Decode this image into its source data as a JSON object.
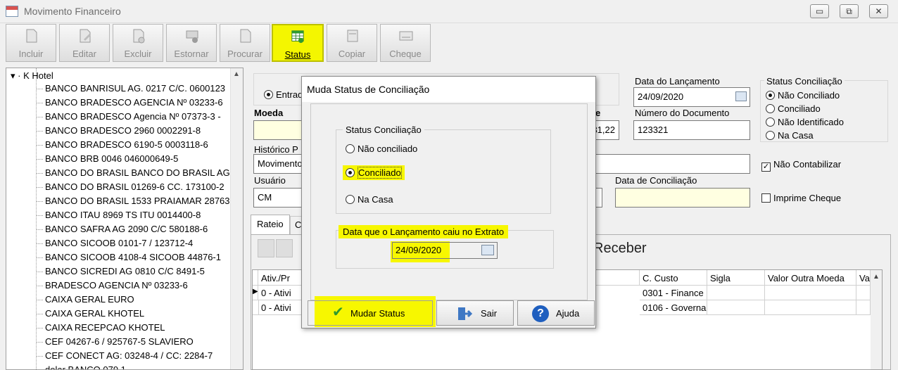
{
  "window": {
    "title": "Movimento Financeiro",
    "controls": [
      "▭",
      "⧉",
      "✕"
    ]
  },
  "toolbar": {
    "buttons": [
      {
        "label": "Incluir",
        "icon": "new-document-icon",
        "enabled": false
      },
      {
        "label": "Editar",
        "icon": "edit-document-icon",
        "enabled": false
      },
      {
        "label": "Excluir",
        "icon": "delete-document-icon",
        "enabled": false
      },
      {
        "label": "Estornar",
        "icon": "reverse-icon",
        "enabled": false
      },
      {
        "label": "Procurar",
        "icon": "search-document-icon",
        "enabled": false
      },
      {
        "label": "Status",
        "icon": "status-grid-icon",
        "enabled": true,
        "highlighted": true
      },
      {
        "label": "Copiar",
        "icon": "copy-icon",
        "enabled": false
      },
      {
        "label": "Cheque",
        "icon": "cheque-icon",
        "enabled": false
      }
    ]
  },
  "tree": {
    "root": "K Hotel",
    "items": [
      "BANCO BANRISUL AG. 0217 C/C. 0600123",
      "BANCO BRADESCO AGENCIA Nº 03233-6",
      "BANCO BRADESCO Agencia Nº 07373-3 -",
      "BANCO BRADESCO 2960 0002291-8",
      "BANCO BRADESCO 6190-5 0003118-6",
      "BANCO BRB 0046 046000649-5",
      "BANCO DO BRASIL BANCO DO BRASIL AG",
      "BANCO DO BRASIL 01269-6 CC. 173100-2",
      "BANCO DO BRASIL 1533 PRAIAMAR 28763",
      "BANCO ITAU 8969 TS ITU 0014400-8",
      "BANCO SAFRA AG 2090 C/C 580188-6",
      "BANCO SICOOB 0101-7 / 123712-4",
      "BANCO SICOOB 4108-4 SICOOB 44876-1",
      "BANCO SICREDI AG 0810 C/C 8491-5",
      "BRADESCO AGENCIA Nº 03233-6",
      "CAIXA GERAL EURO",
      "CAIXA GERAL KHOTEL",
      "CAIXA RECEPCAO KHOTEL",
      "CEF  04267-6 / 925767-5 SLAVIERO",
      "CEF CONECT AG: 03248-4 / CC: 2284-7",
      "dolar BANCO 079 1"
    ]
  },
  "form": {
    "entrada_label": "Entrad",
    "moeda_label": "Moeda",
    "valor_partial": "31,22",
    "valor_label_partial": "e",
    "historico_label": "Histórico P",
    "historico_value": "Movimento",
    "usuario_label": "Usuário",
    "usuario_value": "CM",
    "data_lancamento_label": "Data do Lançamento",
    "data_lancamento_value": "24/09/2020",
    "numero_documento_label": "Número do Documento",
    "numero_documento_value": "123321",
    "data_conciliacao_label": "Data de Conciliação",
    "data_conciliacao_value": "",
    "status_group_title": "Status Conciliação",
    "status_options": [
      "Não Conciliado",
      "Conciliado",
      "Não Identificado",
      "Na Casa"
    ],
    "status_selected": "Não Conciliado",
    "nao_contabilizar_label": "Não Contabilizar",
    "nao_contabilizar_checked": true,
    "imprime_cheque_label": "Imprime Cheque",
    "imprime_cheque_checked": false
  },
  "tabs": [
    "Rateio",
    "C"
  ],
  "receber_label": "Receber",
  "grid": {
    "columns": [
      "Ativ./Pr",
      "C. Custo",
      "Sigla",
      "Valor Outra Moeda",
      "Va"
    ],
    "rows": [
      {
        "ativ": "0 - Ativi",
        "custo": "0301 - Finance",
        "selected": true
      },
      {
        "ativ": "0 - Ativi",
        "custo": "0106 - Governa",
        "selected": false
      }
    ]
  },
  "dialog": {
    "title": "Muda Status de Conciliação",
    "group_title": "Status Conciliação",
    "options": [
      "Não conciliado",
      "Conciliado",
      "Na Casa"
    ],
    "selected": "Conciliado",
    "date_group_title": "Data que o Lançamento caiu no Extrato",
    "date_value": "24/09/2020",
    "buttons": {
      "mudar": "Mudar Status",
      "sair": "Sair",
      "ajuda": "Ajuda"
    }
  },
  "colors": {
    "highlight": "#f7f700",
    "input_yellow": "#ffffe1",
    "help_blue": "#1f5fbf",
    "check_green": "#2e9a2e"
  }
}
